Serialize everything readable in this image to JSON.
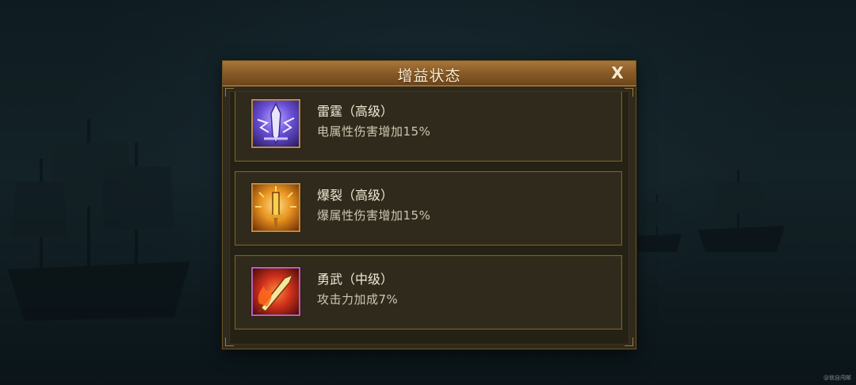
{
  "dialog": {
    "title": "增益状态",
    "close_label": "X"
  },
  "buffs": [
    {
      "name": "雷霆（高级）",
      "description": "电属性伤害增加15%",
      "icon": "lightning-sword-icon",
      "color": "#6a4fd6"
    },
    {
      "name": "爆裂（高级）",
      "description": "爆属性伤害增加15%",
      "icon": "explosive-sword-icon",
      "color": "#e8931f"
    },
    {
      "name": "勇武（中级）",
      "description": "攻击力加成7%",
      "icon": "flaming-blade-icon",
      "color": "#d2321c"
    }
  ],
  "watermark": "@就自闯邮"
}
